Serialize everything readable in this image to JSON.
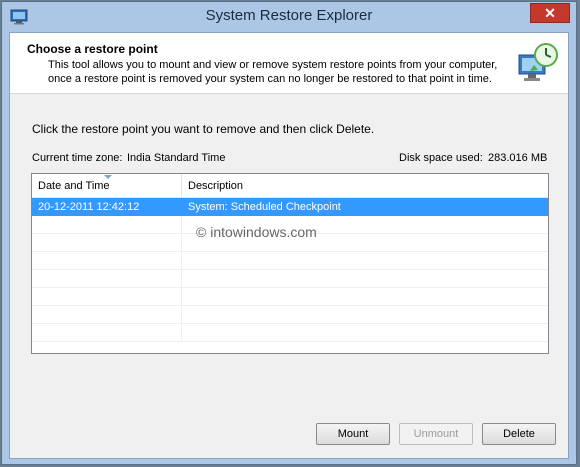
{
  "window": {
    "title": "System Restore Explorer",
    "close_glyph": "✕"
  },
  "header": {
    "title": "Choose a restore point",
    "description": "This tool allows you to mount and view or remove system restore points from your computer, once a restore point is removed your system can no longer be restored to that point in time.",
    "icon": "restore-clock-monitor-icon"
  },
  "instruction": "Click the restore point you want to remove and then click Delete.",
  "info": {
    "timezone_label": "Current time zone:",
    "timezone_value": "India Standard Time",
    "disk_label": "Disk space used:",
    "disk_value": "283.016 MB"
  },
  "table": {
    "columns": [
      "Date and Time",
      "Description"
    ],
    "rows": [
      {
        "date": "20-12-2011 12:42:12",
        "description": "System: Scheduled Checkpoint",
        "selected": true
      },
      {
        "date": "",
        "description": "",
        "selected": false
      },
      {
        "date": "",
        "description": "",
        "selected": false
      },
      {
        "date": "",
        "description": "",
        "selected": false
      },
      {
        "date": "",
        "description": "",
        "selected": false
      },
      {
        "date": "",
        "description": "",
        "selected": false
      },
      {
        "date": "",
        "description": "",
        "selected": false
      },
      {
        "date": "",
        "description": "",
        "selected": false
      }
    ]
  },
  "watermark": "© intowindows.com",
  "buttons": {
    "mount": "Mount",
    "unmount": "Unmount",
    "delete": "Delete"
  },
  "colors": {
    "selection": "#3399ff",
    "close": "#c5382d",
    "frame": "#acc7e6"
  }
}
